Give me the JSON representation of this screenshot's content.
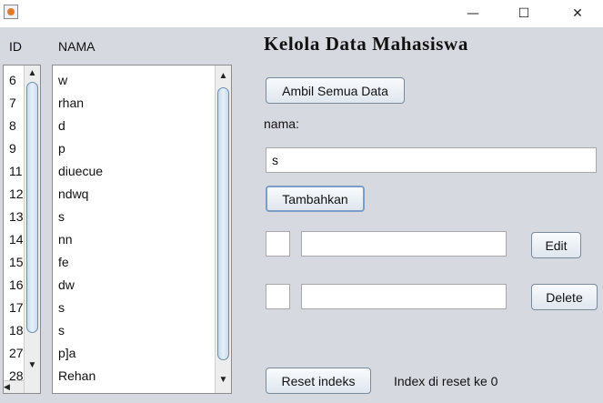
{
  "titlebar": {
    "app_icon": "java-cup-icon",
    "minimize": "—",
    "maximize": "☐",
    "close": "✕"
  },
  "heading": "Kelola Data Mahasiswa",
  "columns": {
    "id": "ID",
    "nama": "NAMA"
  },
  "id_list": [
    "6",
    "7",
    "8",
    "9",
    "11",
    "12",
    "13",
    "14",
    "15",
    "16",
    "17",
    "18",
    "27",
    "28"
  ],
  "nama_list": [
    "w",
    "rhan",
    "d",
    "p",
    "diuecue",
    "ndwq",
    "s",
    "nn",
    "fe",
    "dw",
    "s",
    "s",
    "p]a",
    "Rehan"
  ],
  "buttons": {
    "ambil": "Ambil Semua Data",
    "tambah": "Tambahkan",
    "edit": "Edit",
    "delete": "Delete",
    "reset": "Reset indeks"
  },
  "nama_label": "nama:",
  "nama_value": "s",
  "edit_id_value": "",
  "edit_nama_value": "",
  "delete_id_value": "",
  "delete_nama_value": "",
  "reset_status": "Index di reset ke 0",
  "scroll_arrows": {
    "up": "▲",
    "down": "▼",
    "left": "◀"
  }
}
